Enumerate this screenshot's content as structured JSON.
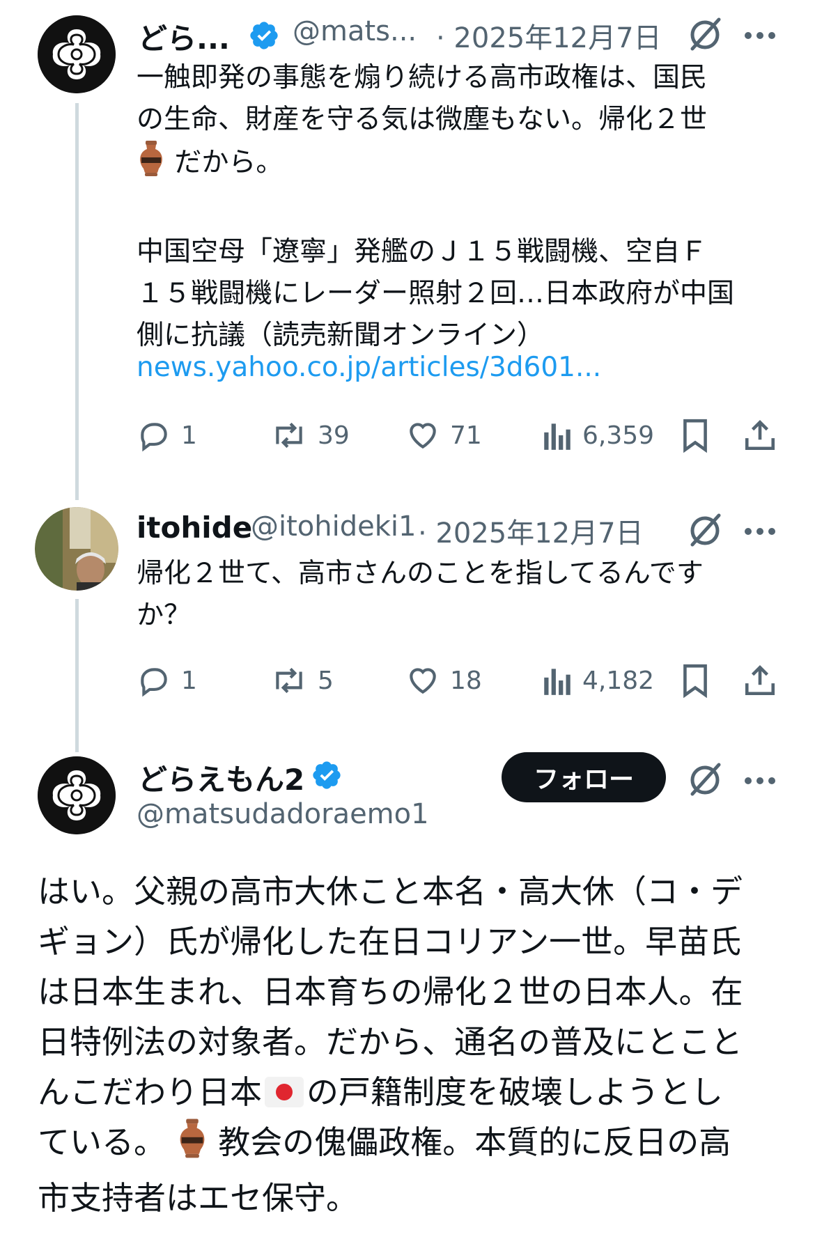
{
  "tweet1": {
    "name": "どら...",
    "handle": "@mats...",
    "date": "· 2025年12月7日",
    "text_part1": "一触即発の事態を煽り続ける高市政権は、国民\nの生命、財産を守る気は微塵もない。帰化２世",
    "text_part2": "だから。",
    "text_part3": "中国空母「遼寧」発艦のＪ１５戦闘機、空自Ｆ\n１５戦闘機にレーダー照射２回…日本政府が中国\n側に抗議（読売新聞オンライン）",
    "link": "news.yahoo.co.jp/articles/3d601...",
    "replies": "1",
    "reposts": "39",
    "likes": "71",
    "views": "6,359"
  },
  "tweet2": {
    "name": "itohide",
    "handle": "@itohideki1",
    "date": "· 2025年12月7日",
    "text": "帰化２世て、高市さんのことを指してるんです\nか？",
    "replies": "1",
    "reposts": "5",
    "likes": "18",
    "views": "4,182"
  },
  "tweet3": {
    "name": "どらえもん2",
    "handle": "@matsudadoraemo1",
    "follow_label": "フォロー",
    "text_part1": "はい。父親の高市大休こと本名・高大休（コ・デ\nギョン）氏が帰化した在日コリアン一世。早苗氏\nは日本生まれ、日本育ちの帰化２世の日本人。在\n日特例法の対象者。だから、通名の普及にとこと\nんこだわり日本",
    "text_part2": "の戸籍制度を破壊しようとし\nている。",
    "text_part3": "教会の傀儡政権。本質的に反日の高\n市支持者はエセ保守。"
  },
  "icons": {
    "verified": "verified-badge-icon",
    "grok": "grok-icon",
    "more": "more-icon",
    "reply": "reply-icon",
    "repost": "repost-icon",
    "like": "like-icon",
    "views": "views-icon",
    "bookmark": "bookmark-icon",
    "share": "share-icon",
    "amphora": "amphora-emoji",
    "flag": "japan-flag-emoji"
  },
  "colors": {
    "text": "#0f1419",
    "secondary": "#536471",
    "link": "#1d9bf0",
    "verified": "#1d9bf0",
    "follow_bg": "#0f1419"
  }
}
